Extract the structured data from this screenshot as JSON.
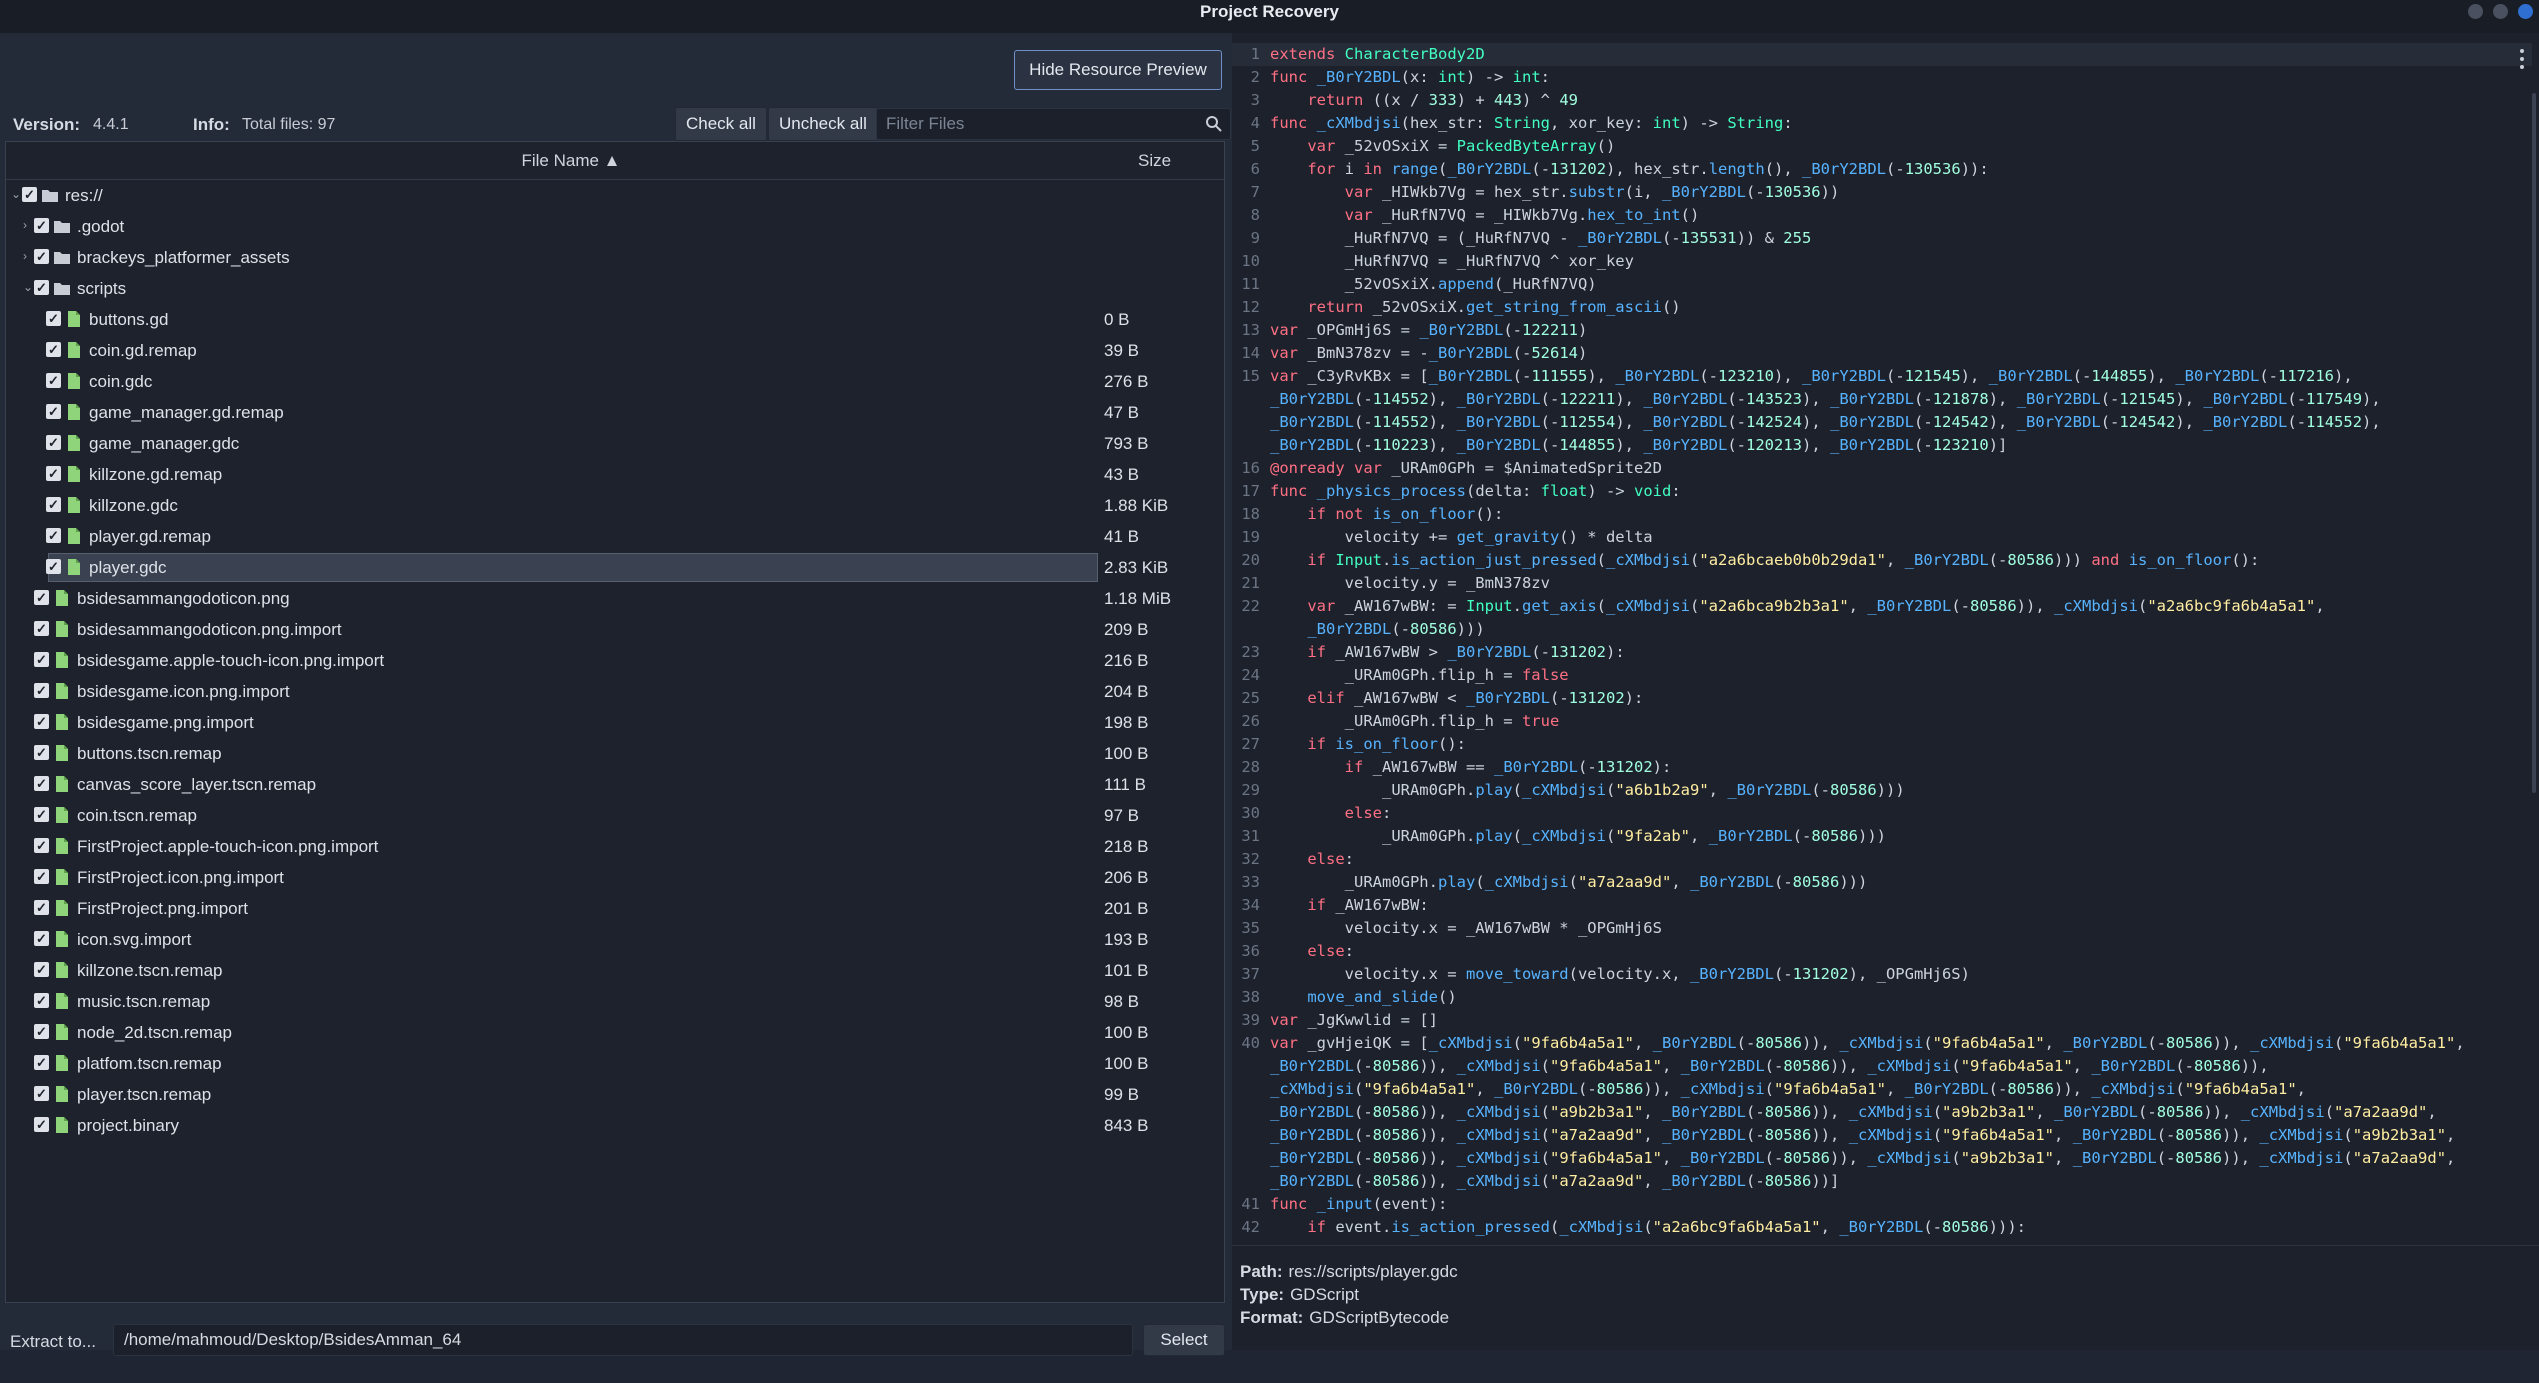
{
  "window": {
    "title": "Project Recovery"
  },
  "toolbar": {
    "hide_preview": "Hide Resource Preview",
    "version_label": "Version:",
    "version_value": "4.4.1",
    "info_label": "Info:",
    "info_value": "Total files: 97",
    "check_all": "Check all",
    "uncheck_all": "Uncheck all",
    "filter_placeholder": "Filter Files"
  },
  "tree": {
    "header_name": "File Name ▲",
    "header_size": "Size",
    "rows": [
      {
        "name": "res://",
        "size": "",
        "depth": 0,
        "type": "folder",
        "expanded": true
      },
      {
        "name": ".godot",
        "size": "",
        "depth": 1,
        "type": "folder",
        "expanded": false
      },
      {
        "name": "brackeys_platformer_assets",
        "size": "",
        "depth": 1,
        "type": "folder",
        "expanded": false
      },
      {
        "name": "scripts",
        "size": "",
        "depth": 1,
        "type": "folder",
        "expanded": true
      },
      {
        "name": "buttons.gd",
        "size": "0 B",
        "depth": 2,
        "type": "file"
      },
      {
        "name": "coin.gd.remap",
        "size": "39 B",
        "depth": 2,
        "type": "file"
      },
      {
        "name": "coin.gdc",
        "size": "276 B",
        "depth": 2,
        "type": "file"
      },
      {
        "name": "game_manager.gd.remap",
        "size": "47 B",
        "depth": 2,
        "type": "file"
      },
      {
        "name": "game_manager.gdc",
        "size": "793 B",
        "depth": 2,
        "type": "file"
      },
      {
        "name": "killzone.gd.remap",
        "size": "43 B",
        "depth": 2,
        "type": "file"
      },
      {
        "name": "killzone.gdc",
        "size": "1.88 KiB",
        "depth": 2,
        "type": "file"
      },
      {
        "name": "player.gd.remap",
        "size": "41 B",
        "depth": 2,
        "type": "file"
      },
      {
        "name": "player.gdc",
        "size": "2.83 KiB",
        "depth": 2,
        "type": "file",
        "selected": true
      },
      {
        "name": "bsidesammangodoticon.png",
        "size": "1.18 MiB",
        "depth": 1,
        "type": "file"
      },
      {
        "name": "bsidesammangodoticon.png.import",
        "size": "209 B",
        "depth": 1,
        "type": "file"
      },
      {
        "name": "bsidesgame.apple-touch-icon.png.import",
        "size": "216 B",
        "depth": 1,
        "type": "file"
      },
      {
        "name": "bsidesgame.icon.png.import",
        "size": "204 B",
        "depth": 1,
        "type": "file"
      },
      {
        "name": "bsidesgame.png.import",
        "size": "198 B",
        "depth": 1,
        "type": "file"
      },
      {
        "name": "buttons.tscn.remap",
        "size": "100 B",
        "depth": 1,
        "type": "file"
      },
      {
        "name": "canvas_score_layer.tscn.remap",
        "size": "111 B",
        "depth": 1,
        "type": "file"
      },
      {
        "name": "coin.tscn.remap",
        "size": "97 B",
        "depth": 1,
        "type": "file"
      },
      {
        "name": "FirstProject.apple-touch-icon.png.import",
        "size": "218 B",
        "depth": 1,
        "type": "file"
      },
      {
        "name": "FirstProject.icon.png.import",
        "size": "206 B",
        "depth": 1,
        "type": "file"
      },
      {
        "name": "FirstProject.png.import",
        "size": "201 B",
        "depth": 1,
        "type": "file"
      },
      {
        "name": "icon.svg.import",
        "size": "193 B",
        "depth": 1,
        "type": "file"
      },
      {
        "name": "killzone.tscn.remap",
        "size": "101 B",
        "depth": 1,
        "type": "file"
      },
      {
        "name": "music.tscn.remap",
        "size": "98 B",
        "depth": 1,
        "type": "file"
      },
      {
        "name": "node_2d.tscn.remap",
        "size": "100 B",
        "depth": 1,
        "type": "file"
      },
      {
        "name": "platfom.tscn.remap",
        "size": "100 B",
        "depth": 1,
        "type": "file"
      },
      {
        "name": "player.tscn.remap",
        "size": "99 B",
        "depth": 1,
        "type": "file"
      },
      {
        "name": "project.binary",
        "size": "843 B",
        "depth": 1,
        "type": "file"
      }
    ]
  },
  "bottom": {
    "extract_label": "Extract to...",
    "path_value": "/home/mahmoud/Desktop/BsidesAmman_64",
    "select": "Select"
  },
  "code": {
    "lines": [
      {
        "n": "1",
        "t": "extends CharacterBody2D"
      },
      {
        "n": "2",
        "t": "func _B0rY2BDL(x: int) -> int:"
      },
      {
        "n": "3",
        "t": "    return ((x / 333) + 443) ^ 49"
      },
      {
        "n": "4",
        "t": "func _cXMbdjsi(hex_str: String, xor_key: int) -> String:"
      },
      {
        "n": "5",
        "t": "    var _52vOSxiX = PackedByteArray()"
      },
      {
        "n": "6",
        "t": "    for i in range(_B0rY2BDL(-131202), hex_str.length(), _B0rY2BDL(-130536)):"
      },
      {
        "n": "7",
        "t": "        var _HIWkb7Vg = hex_str.substr(i, _B0rY2BDL(-130536))"
      },
      {
        "n": "8",
        "t": "        var _HuRfN7VQ = _HIWkb7Vg.hex_to_int()"
      },
      {
        "n": "9",
        "t": "        _HuRfN7VQ = (_HuRfN7VQ - _B0rY2BDL(-135531)) & 255"
      },
      {
        "n": "10",
        "t": "        _HuRfN7VQ = _HuRfN7VQ ^ xor_key"
      },
      {
        "n": "11",
        "t": "        _52vOSxiX.append(_HuRfN7VQ)"
      },
      {
        "n": "12",
        "t": "    return _52vOSxiX.get_string_from_ascii()"
      },
      {
        "n": "13",
        "t": "var _OPGmHj6S = _B0rY2BDL(-122211)"
      },
      {
        "n": "14",
        "t": "var _BmN378zv = -_B0rY2BDL(-52614)"
      },
      {
        "n": "15",
        "t": "var _C3yRvKBx = [_B0rY2BDL(-111555), _B0rY2BDL(-123210), _B0rY2BDL(-121545), _B0rY2BDL(-144855), _B0rY2BDL(-117216),"
      },
      {
        "n": "",
        "t": "_B0rY2BDL(-114552), _B0rY2BDL(-122211), _B0rY2BDL(-143523), _B0rY2BDL(-121878), _B0rY2BDL(-121545), _B0rY2BDL(-117549),"
      },
      {
        "n": "",
        "t": "_B0rY2BDL(-114552), _B0rY2BDL(-112554), _B0rY2BDL(-142524), _B0rY2BDL(-124542), _B0rY2BDL(-124542), _B0rY2BDL(-114552),"
      },
      {
        "n": "",
        "t": "_B0rY2BDL(-110223), _B0rY2BDL(-144855), _B0rY2BDL(-120213), _B0rY2BDL(-123210)]"
      },
      {
        "n": "16",
        "t": "@onready var _URAm0GPh = $AnimatedSprite2D"
      },
      {
        "n": "17",
        "t": "func _physics_process(delta: float) -> void:"
      },
      {
        "n": "18",
        "t": "    if not is_on_floor():"
      },
      {
        "n": "19",
        "t": "        velocity += get_gravity() * delta"
      },
      {
        "n": "20",
        "t": "    if Input.is_action_just_pressed(_cXMbdjsi(\"a2a6bcaeb0b0b29da1\", _B0rY2BDL(-80586))) and is_on_floor():"
      },
      {
        "n": "21",
        "t": "        velocity.y = _BmN378zv"
      },
      {
        "n": "22",
        "t": "    var _AW167wBW: = Input.get_axis(_cXMbdjsi(\"a2a6bca9b2b3a1\", _B0rY2BDL(-80586)), _cXMbdjsi(\"a2a6bc9fa6b4a5a1\","
      },
      {
        "n": "",
        "t": "    _B0rY2BDL(-80586)))"
      },
      {
        "n": "23",
        "t": "    if _AW167wBW > _B0rY2BDL(-131202):"
      },
      {
        "n": "24",
        "t": "        _URAm0GPh.flip_h = false"
      },
      {
        "n": "25",
        "t": "    elif _AW167wBW < _B0rY2BDL(-131202):"
      },
      {
        "n": "26",
        "t": "        _URAm0GPh.flip_h = true"
      },
      {
        "n": "27",
        "t": "    if is_on_floor():"
      },
      {
        "n": "28",
        "t": "        if _AW167wBW == _B0rY2BDL(-131202):"
      },
      {
        "n": "29",
        "t": "            _URAm0GPh.play(_cXMbdjsi(\"a6b1b2a9\", _B0rY2BDL(-80586)))"
      },
      {
        "n": "30",
        "t": "        else:"
      },
      {
        "n": "31",
        "t": "            _URAm0GPh.play(_cXMbdjsi(\"9fa2ab\", _B0rY2BDL(-80586)))"
      },
      {
        "n": "32",
        "t": "    else:"
      },
      {
        "n": "33",
        "t": "        _URAm0GPh.play(_cXMbdjsi(\"a7a2aa9d\", _B0rY2BDL(-80586)))"
      },
      {
        "n": "34",
        "t": "    if _AW167wBW:"
      },
      {
        "n": "35",
        "t": "        velocity.x = _AW167wBW * _OPGmHj6S"
      },
      {
        "n": "36",
        "t": "    else:"
      },
      {
        "n": "37",
        "t": "        velocity.x = move_toward(velocity.x, _B0rY2BDL(-131202), _OPGmHj6S)"
      },
      {
        "n": "38",
        "t": "    move_and_slide()"
      },
      {
        "n": "39",
        "t": "var _JgKwwlid = []"
      },
      {
        "n": "40",
        "t": "var _gvHjeiQK = [_cXMbdjsi(\"9fa6b4a5a1\", _B0rY2BDL(-80586)), _cXMbdjsi(\"9fa6b4a5a1\", _B0rY2BDL(-80586)), _cXMbdjsi(\"9fa6b4a5a1\","
      },
      {
        "n": "",
        "t": "_B0rY2BDL(-80586)), _cXMbdjsi(\"9fa6b4a5a1\", _B0rY2BDL(-80586)), _cXMbdjsi(\"9fa6b4a5a1\", _B0rY2BDL(-80586)),"
      },
      {
        "n": "",
        "t": "_cXMbdjsi(\"9fa6b4a5a1\", _B0rY2BDL(-80586)), _cXMbdjsi(\"9fa6b4a5a1\", _B0rY2BDL(-80586)), _cXMbdjsi(\"9fa6b4a5a1\","
      },
      {
        "n": "",
        "t": "_B0rY2BDL(-80586)), _cXMbdjsi(\"a9b2b3a1\", _B0rY2BDL(-80586)), _cXMbdjsi(\"a9b2b3a1\", _B0rY2BDL(-80586)), _cXMbdjsi(\"a7a2aa9d\","
      },
      {
        "n": "",
        "t": "_B0rY2BDL(-80586)), _cXMbdjsi(\"a7a2aa9d\", _B0rY2BDL(-80586)), _cXMbdjsi(\"9fa6b4a5a1\", _B0rY2BDL(-80586)), _cXMbdjsi(\"a9b2b3a1\","
      },
      {
        "n": "",
        "t": "_B0rY2BDL(-80586)), _cXMbdjsi(\"9fa6b4a5a1\", _B0rY2BDL(-80586)), _cXMbdjsi(\"a9b2b3a1\", _B0rY2BDL(-80586)), _cXMbdjsi(\"a7a2aa9d\","
      },
      {
        "n": "",
        "t": "_B0rY2BDL(-80586)), _cXMbdjsi(\"a7a2aa9d\", _B0rY2BDL(-80586))]"
      },
      {
        "n": "41",
        "t": "func _input(event):"
      },
      {
        "n": "42",
        "t": "    if event.is_action_pressed(_cXMbdjsi(\"a2a6bc9fa6b4a5a1\", _B0rY2BDL(-80586))):"
      }
    ]
  },
  "info": {
    "path_label": "Path:",
    "path_value": "res://scripts/player.gdc",
    "type_label": "Type:",
    "type_value": "GDScript",
    "format_label": "Format:",
    "format_value": "GDScriptBytecode"
  }
}
